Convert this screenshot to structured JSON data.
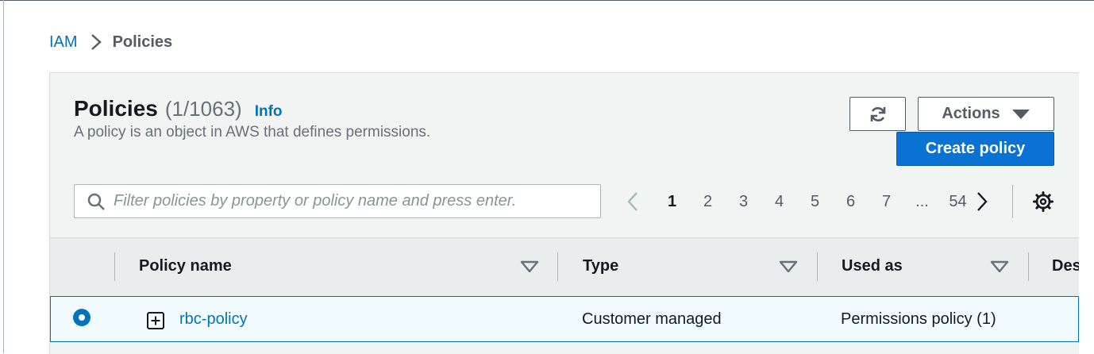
{
  "breadcrumb": {
    "root": "IAM",
    "current": "Policies"
  },
  "header": {
    "title": "Policies",
    "count": "(1/1063)",
    "info": "Info",
    "description": "A policy is an object in AWS that defines permissions."
  },
  "toolbar": {
    "refresh_icon": "refresh-icon",
    "actions_label": "Actions",
    "create_label": "Create policy"
  },
  "search": {
    "placeholder": "Filter policies by property or policy name and press enter.",
    "value": ""
  },
  "pagination": {
    "pages": [
      "1",
      "2",
      "3",
      "4",
      "5",
      "6",
      "7",
      "...",
      "54"
    ],
    "current": "1"
  },
  "table": {
    "columns": [
      "Policy name",
      "Type",
      "Used as",
      "Des"
    ],
    "rows": [
      {
        "selected": true,
        "name": "rbc-policy",
        "type": "Customer managed",
        "used_as": "Permissions policy (1)"
      }
    ]
  },
  "colors": {
    "link": "#0073bb",
    "primary_button": "#0972d3",
    "panel_bg": "#f2f3f3",
    "selected_row_bg": "#f1faff"
  }
}
